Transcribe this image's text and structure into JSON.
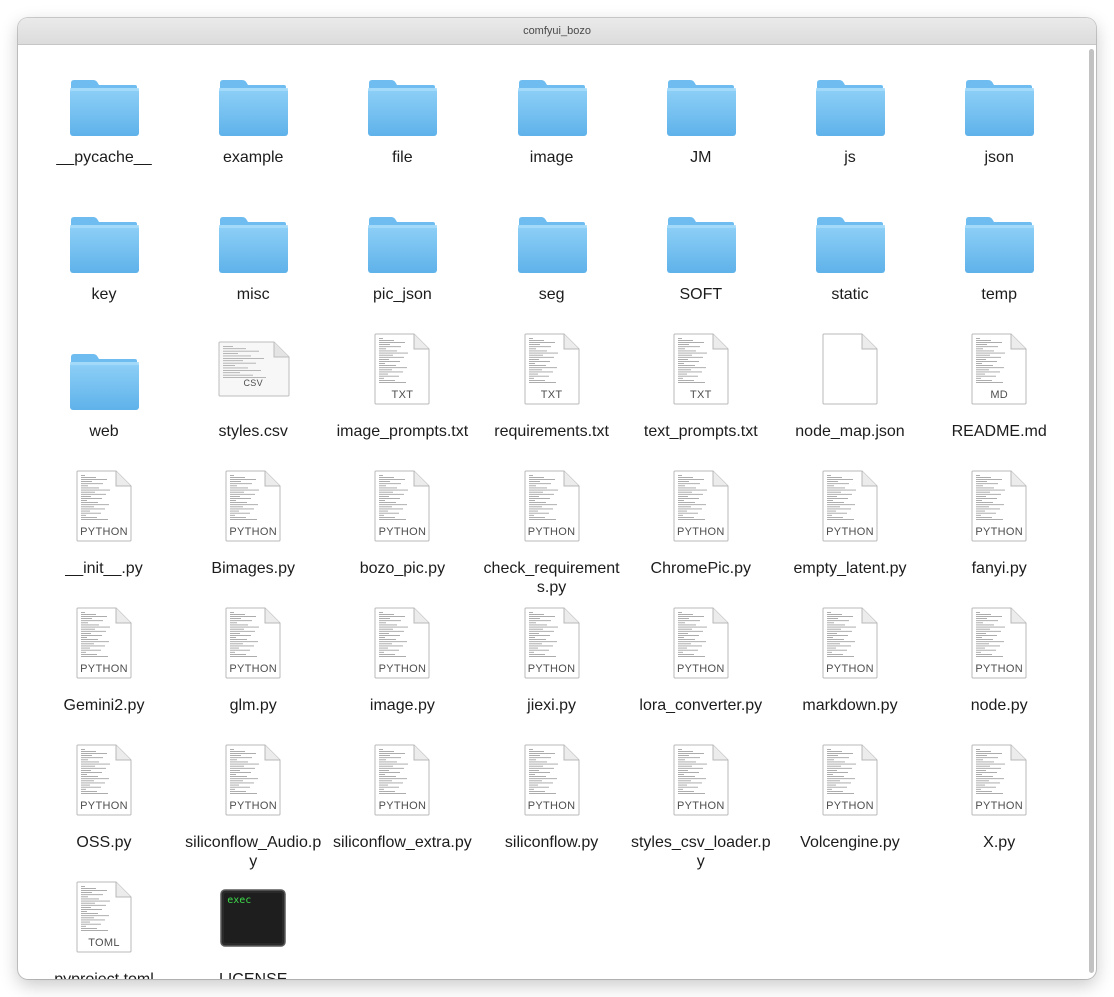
{
  "window": {
    "title": "comfyui_bozo"
  },
  "items": [
    {
      "name": "__pycache__",
      "kind": "folder",
      "icon": "folder-icon"
    },
    {
      "name": "example",
      "kind": "folder",
      "icon": "folder-icon"
    },
    {
      "name": "file",
      "kind": "folder",
      "icon": "folder-icon"
    },
    {
      "name": "image",
      "kind": "folder",
      "icon": "folder-icon"
    },
    {
      "name": "JM",
      "kind": "folder",
      "icon": "folder-icon"
    },
    {
      "name": "js",
      "kind": "folder",
      "icon": "folder-icon"
    },
    {
      "name": "json",
      "kind": "folder",
      "icon": "folder-icon"
    },
    {
      "name": "key",
      "kind": "folder",
      "icon": "folder-icon"
    },
    {
      "name": "misc",
      "kind": "folder",
      "icon": "folder-icon"
    },
    {
      "name": "pic_json",
      "kind": "folder",
      "icon": "folder-icon"
    },
    {
      "name": "seg",
      "kind": "folder",
      "icon": "folder-icon"
    },
    {
      "name": "SOFT",
      "kind": "folder",
      "icon": "folder-icon"
    },
    {
      "name": "static",
      "kind": "folder",
      "icon": "folder-icon"
    },
    {
      "name": "temp",
      "kind": "folder",
      "icon": "folder-icon"
    },
    {
      "name": "web",
      "kind": "folder",
      "icon": "folder-icon"
    },
    {
      "name": "styles.csv",
      "kind": "csv",
      "tag": "CSV",
      "icon": "csv-file-icon"
    },
    {
      "name": "image_prompts.txt",
      "kind": "doc",
      "tag": "TXT",
      "icon": "txt-file-icon"
    },
    {
      "name": "requirements.txt",
      "kind": "doc",
      "tag": "TXT",
      "icon": "txt-file-icon"
    },
    {
      "name": "text_prompts.txt",
      "kind": "doc",
      "tag": "TXT",
      "icon": "txt-file-icon"
    },
    {
      "name": "node_map.json",
      "kind": "blank",
      "tag": "",
      "icon": "json-file-icon"
    },
    {
      "name": "README.md",
      "kind": "doc",
      "tag": "MD",
      "icon": "md-file-icon"
    },
    {
      "name": "__init__.py",
      "kind": "doc",
      "tag": "PYTHON",
      "icon": "python-file-icon"
    },
    {
      "name": "Bimages.py",
      "kind": "doc",
      "tag": "PYTHON",
      "icon": "python-file-icon"
    },
    {
      "name": "bozo_pic.py",
      "kind": "doc",
      "tag": "PYTHON",
      "icon": "python-file-icon"
    },
    {
      "name": "check_requirements.py",
      "kind": "doc",
      "tag": "PYTHON",
      "icon": "python-file-icon"
    },
    {
      "name": "ChromePic.py",
      "kind": "doc",
      "tag": "PYTHON",
      "icon": "python-file-icon"
    },
    {
      "name": "empty_latent.py",
      "kind": "doc",
      "tag": "PYTHON",
      "icon": "python-file-icon"
    },
    {
      "name": "fanyi.py",
      "kind": "doc",
      "tag": "PYTHON",
      "icon": "python-file-icon"
    },
    {
      "name": "Gemini2.py",
      "kind": "doc",
      "tag": "PYTHON",
      "icon": "python-file-icon"
    },
    {
      "name": "glm.py",
      "kind": "doc",
      "tag": "PYTHON",
      "icon": "python-file-icon"
    },
    {
      "name": "image.py",
      "kind": "doc",
      "tag": "PYTHON",
      "icon": "python-file-icon"
    },
    {
      "name": "jiexi.py",
      "kind": "doc",
      "tag": "PYTHON",
      "icon": "python-file-icon"
    },
    {
      "name": "lora_converter.py",
      "kind": "doc",
      "tag": "PYTHON",
      "icon": "python-file-icon"
    },
    {
      "name": "markdown.py",
      "kind": "doc",
      "tag": "PYTHON",
      "icon": "python-file-icon"
    },
    {
      "name": "node.py",
      "kind": "doc",
      "tag": "PYTHON",
      "icon": "python-file-icon"
    },
    {
      "name": "OSS.py",
      "kind": "doc",
      "tag": "PYTHON",
      "icon": "python-file-icon"
    },
    {
      "name": "siliconflow_Audio.py",
      "kind": "doc",
      "tag": "PYTHON",
      "icon": "python-file-icon"
    },
    {
      "name": "siliconflow_extra.py",
      "kind": "doc",
      "tag": "PYTHON",
      "icon": "python-file-icon"
    },
    {
      "name": "siliconflow.py",
      "kind": "doc",
      "tag": "PYTHON",
      "icon": "python-file-icon"
    },
    {
      "name": "styles_csv_loader.py",
      "kind": "doc",
      "tag": "PYTHON",
      "icon": "python-file-icon"
    },
    {
      "name": "Volcengine.py",
      "kind": "doc",
      "tag": "PYTHON",
      "icon": "python-file-icon"
    },
    {
      "name": "X.py",
      "kind": "doc",
      "tag": "PYTHON",
      "icon": "python-file-icon"
    },
    {
      "name": "pyproject.toml",
      "kind": "doc",
      "tag": "TOML",
      "icon": "toml-file-icon"
    },
    {
      "name": "LICENSE",
      "kind": "exec",
      "tag": "exec",
      "icon": "exec-file-icon"
    }
  ]
}
